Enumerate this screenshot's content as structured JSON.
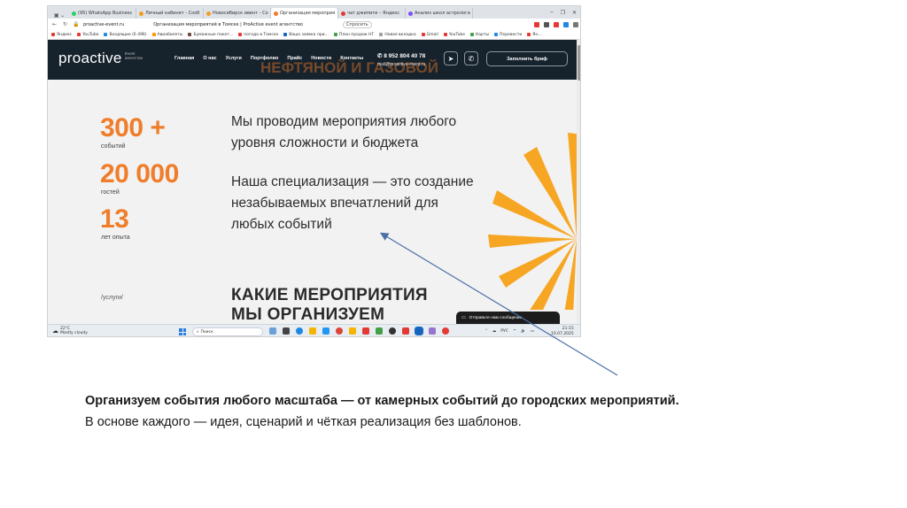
{
  "browser": {
    "tabs": [
      {
        "label": "(95) WhatsApp Business",
        "color": "#25d366",
        "active": false
      },
      {
        "label": "Личный кабинет - Сооб",
        "color": "#f29c1f",
        "active": false
      },
      {
        "label": "Новосибирск ивент - Со",
        "color": "#f29c1f",
        "active": false
      },
      {
        "label": "Организация мероприя",
        "color": "#ef7d2a",
        "active": true
      },
      {
        "label": "чат джипити – Яндекс",
        "color": "#e53935",
        "active": false
      },
      {
        "label": "Анализ школ астролога",
        "color": "#7c4dff",
        "active": false
      }
    ],
    "url": "proactive-event.ru",
    "page_title": "Организация мероприятий в Томске | ProActive event агентство",
    "ask_button": "Спросить",
    "bookmarks": [
      {
        "label": "Яндекс",
        "color": "#e53935"
      },
      {
        "label": "YouTube",
        "color": "#e53935"
      },
      {
        "label": "Входящие (6 496)",
        "color": "#1e88e5"
      },
      {
        "label": "Авиабилеты",
        "color": "#ff9800"
      },
      {
        "label": "Бумажные пакет...",
        "color": "#6d4c41"
      },
      {
        "label": "погода в Томске",
        "color": "#e53935"
      },
      {
        "label": "Ваша заявка при...",
        "color": "#1565c0"
      },
      {
        "label": "План продаж НГ",
        "color": "#43a047"
      },
      {
        "label": "Новая вкладка",
        "color": "#9e9e9e"
      },
      {
        "label": "Gmail",
        "color": "#e53935"
      },
      {
        "label": "YouTube",
        "color": "#e53935"
      },
      {
        "label": "Карты",
        "color": "#43a047"
      },
      {
        "label": "Перевести",
        "color": "#1e88e5"
      },
      {
        "label": "Ян...",
        "color": "#e53935"
      }
    ]
  },
  "site": {
    "logo": "proactive",
    "logo_sub": "Event агентство",
    "hero_line1": "НЕФТЯНОЙ И ГАЗОВОЙ",
    "menu": [
      "Главная",
      "О нас",
      "Услуги",
      "Портфолио",
      "Прайс",
      "Новости",
      "Контакты"
    ],
    "phone": "8 952 804 40 78",
    "email": "mail@proactive-event.ru",
    "brief_button": "Заполнить бриф",
    "stats": [
      {
        "value": "300 +",
        "label": "событий"
      },
      {
        "value": "20 000",
        "label": "гостей"
      },
      {
        "value": "13",
        "label": "лет опыта"
      }
    ],
    "lead1": [
      "Мы проводим мероприятия любого",
      "уровня сложности и бюджета"
    ],
    "lead2": [
      "Наша специализация — это создание",
      "незабываемых впечатлений для",
      "любых событий"
    ],
    "services_link": "/услуги/",
    "section_title": [
      "КАКИЕ МЕРОПРИЯТИЯ",
      "МЫ ОРГАНИЗУЕМ"
    ],
    "chat_label": "Отправьте нам сообщение"
  },
  "taskbar": {
    "temperature": "22°C",
    "weather": "Mostly cloudy",
    "search_placeholder": "Поиск",
    "language": "РУС",
    "time": "21:15",
    "date": "10.07.2025"
  },
  "caption": {
    "line1": "Организуем события любого масштаба — от камерных событий до городских мероприятий.",
    "line2": "В основе каждого — идея, сценарий и чёткая реализация без шаблонов."
  },
  "colors": {
    "accent": "#ef7d2a",
    "header_bg": "#16222c",
    "arrow": "#4a6fa5"
  }
}
